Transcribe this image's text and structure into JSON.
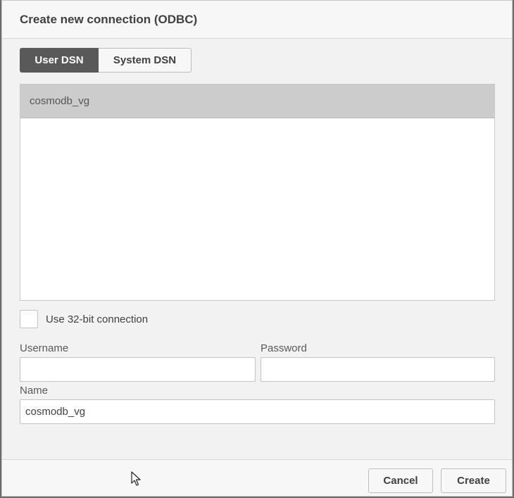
{
  "dialog": {
    "title": "Create new connection (ODBC)"
  },
  "tabs": [
    {
      "label": "User DSN",
      "active": true
    },
    {
      "label": "System DSN",
      "active": false
    }
  ],
  "dsn_list": {
    "items": [
      {
        "label": "cosmodb_vg",
        "selected": true
      }
    ]
  },
  "checkbox_32bit": {
    "label": "Use 32-bit connection",
    "checked": false
  },
  "fields": {
    "username": {
      "label": "Username",
      "value": ""
    },
    "password": {
      "label": "Password",
      "value": ""
    },
    "name": {
      "label": "Name",
      "value": "cosmodb_vg"
    }
  },
  "footer": {
    "cancel_label": "Cancel",
    "create_label": "Create"
  },
  "colors": {
    "active_tab_bg": "#595959",
    "selected_row_bg": "#cccccc",
    "dialog_bg": "#f2f2f2"
  },
  "icons": {
    "cursor": "mouse-pointer-icon"
  }
}
